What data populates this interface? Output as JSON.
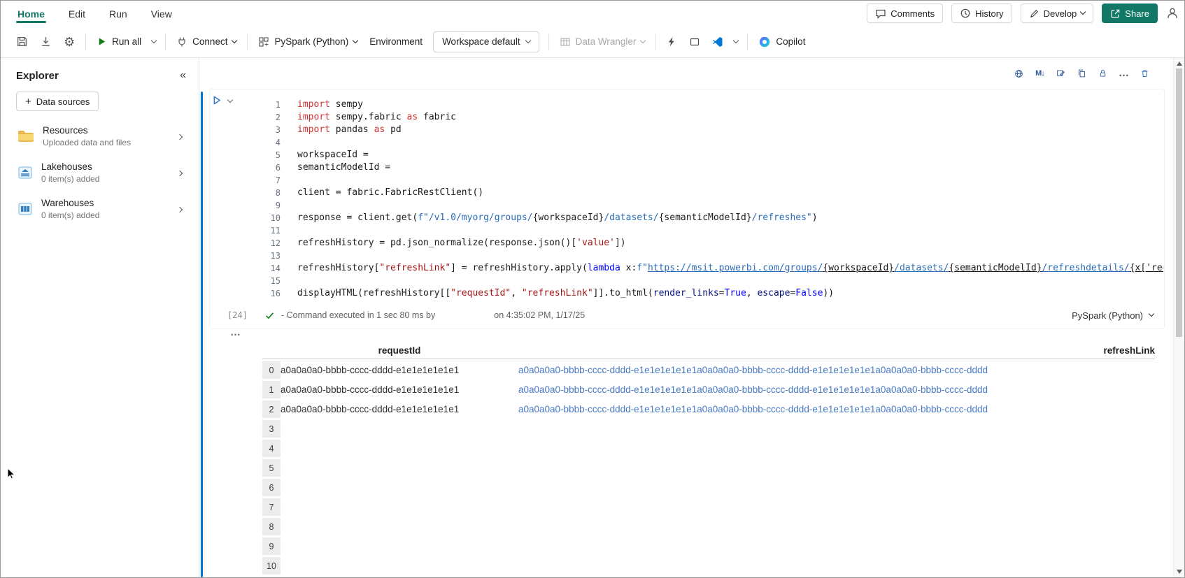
{
  "colors": {
    "accent_green": "#117865",
    "active_cell_blue": "#0078d4",
    "link_blue": "#4779c4",
    "run_green": "#107c10"
  },
  "glyphs": {
    "gear": "⚙",
    "plus": "+",
    "collapse": "«",
    "markdown": "M↓",
    "more": "…",
    "output_handle": "…"
  },
  "menu": {
    "tabs": [
      "Home",
      "Edit",
      "Run",
      "View"
    ],
    "comments": "Comments",
    "history": "History",
    "develop": "Develop",
    "share": "Share"
  },
  "toolbar": {
    "run_all": "Run all",
    "connect": "Connect",
    "kernel": "PySpark (Python)",
    "environment": "Environment",
    "workspace": "Workspace default",
    "data_wrangler": "Data Wrangler",
    "copilot": "Copilot"
  },
  "explorer": {
    "title": "Explorer",
    "add_button": "Data sources",
    "items": [
      {
        "label": "Resources",
        "sub": "Uploaded data and files",
        "icon": "folder-icon"
      },
      {
        "label": "Lakehouses",
        "sub": "0 item(s) added",
        "icon": "lakehouse-icon"
      },
      {
        "label": "Warehouses",
        "sub": "0 item(s) added",
        "icon": "warehouse-icon"
      }
    ]
  },
  "cell": {
    "execution_count": "[24]",
    "status": "- Command executed in 1 sec 80 ms by",
    "status_time": "on 4:35:02 PM, 1/17/25",
    "kernel_label": "PySpark (Python)",
    "code_lines": [
      [
        {
          "t": "import",
          "c": "kw"
        },
        {
          "t": " sempy",
          "c": "pl"
        }
      ],
      [
        {
          "t": "import",
          "c": "kw"
        },
        {
          "t": " sempy.fabric ",
          "c": "pl"
        },
        {
          "t": "as",
          "c": "kw"
        },
        {
          "t": " fabric",
          "c": "pl"
        }
      ],
      [
        {
          "t": "import",
          "c": "kw"
        },
        {
          "t": " pandas ",
          "c": "pl"
        },
        {
          "t": "as",
          "c": "kw"
        },
        {
          "t": " pd",
          "c": "pl"
        }
      ],
      [],
      [
        {
          "t": "workspaceId = ",
          "c": "pl"
        }
      ],
      [
        {
          "t": "semanticModelId = ",
          "c": "pl"
        }
      ],
      [],
      [
        {
          "t": "client = fabric.FabricRestClient()",
          "c": "pl"
        }
      ],
      [],
      [
        {
          "t": "response = client.get(",
          "c": "pl"
        },
        {
          "t": "f\"/v1.0/myorg/groups/",
          "c": "fstr"
        },
        {
          "t": "{workspaceId}",
          "c": "br"
        },
        {
          "t": "/datasets/",
          "c": "fstr"
        },
        {
          "t": "{semanticModelId}",
          "c": "br"
        },
        {
          "t": "/refreshes\"",
          "c": "fstr"
        },
        {
          "t": ")",
          "c": "pl"
        }
      ],
      [],
      [
        {
          "t": "refreshHistory = pd.json_normalize(response.json()[",
          "c": "pl"
        },
        {
          "t": "'value'",
          "c": "str"
        },
        {
          "t": "])",
          "c": "pl"
        }
      ],
      [],
      [
        {
          "t": "refreshHistory[",
          "c": "pl"
        },
        {
          "t": "\"refreshLink\"",
          "c": "str"
        },
        {
          "t": "] = refreshHistory.apply(",
          "c": "pl"
        },
        {
          "t": "lambda",
          "c": "kwb"
        },
        {
          "t": " x:",
          "c": "pl"
        },
        {
          "t": "f\"",
          "c": "fstr"
        },
        {
          "t": "https://msit.powerbi.com/groups/",
          "c": "lnk"
        },
        {
          "t": "{workspaceId}",
          "c": "blnk"
        },
        {
          "t": "/datasets/",
          "c": "lnk"
        },
        {
          "t": "{semanticModelId}",
          "c": "blnk"
        },
        {
          "t": "/refreshdetails/",
          "c": "lnk"
        },
        {
          "t": "{x['requ",
          "c": "blnk"
        }
      ],
      [],
      [
        {
          "t": "displayHTML(refreshHistory[[",
          "c": "pl"
        },
        {
          "t": "\"requestId\"",
          "c": "str"
        },
        {
          "t": ", ",
          "c": "pl"
        },
        {
          "t": "\"refreshLink\"",
          "c": "str"
        },
        {
          "t": "]].to_html(",
          "c": "pl"
        },
        {
          "t": "render_links",
          "c": "param"
        },
        {
          "t": "=",
          "c": "pl"
        },
        {
          "t": "True",
          "c": "kwb"
        },
        {
          "t": ", ",
          "c": "pl"
        },
        {
          "t": "escape",
          "c": "param"
        },
        {
          "t": "=",
          "c": "pl"
        },
        {
          "t": "False",
          "c": "kwb"
        },
        {
          "t": "))",
          "c": "pl"
        }
      ]
    ]
  },
  "output": {
    "columns": [
      "requestId",
      "refreshLink"
    ],
    "rows": [
      {
        "index": "0",
        "requestId": "a0a0a0a0-bbbb-cccc-dddd-e1e1e1e1e1e1",
        "refreshLink": "a0a0a0a0-bbbb-cccc-dddd-e1e1e1e1e1e1a0a0a0a0-bbbb-cccc-dddd-e1e1e1e1e1e1a0a0a0a0-bbbb-cccc-dddd"
      },
      {
        "index": "1",
        "requestId": "a0a0a0a0-bbbb-cccc-dddd-e1e1e1e1e1e1",
        "refreshLink": "a0a0a0a0-bbbb-cccc-dddd-e1e1e1e1e1e1a0a0a0a0-bbbb-cccc-dddd-e1e1e1e1e1e1a0a0a0a0-bbbb-cccc-dddd"
      },
      {
        "index": "2",
        "requestId": "a0a0a0a0-bbbb-cccc-dddd-e1e1e1e1e1e1",
        "refreshLink": "a0a0a0a0-bbbb-cccc-dddd-e1e1e1e1e1e1a0a0a0a0-bbbb-cccc-dddd-e1e1e1e1e1e1a0a0a0a0-bbbb-cccc-dddd"
      },
      {
        "index": "3",
        "requestId": "",
        "refreshLink": ""
      },
      {
        "index": "4",
        "requestId": "",
        "refreshLink": ""
      },
      {
        "index": "5",
        "requestId": "",
        "refreshLink": ""
      },
      {
        "index": "6",
        "requestId": "",
        "refreshLink": ""
      },
      {
        "index": "7",
        "requestId": "",
        "refreshLink": ""
      },
      {
        "index": "8",
        "requestId": "",
        "refreshLink": ""
      },
      {
        "index": "9",
        "requestId": "",
        "refreshLink": ""
      },
      {
        "index": "10",
        "requestId": "",
        "refreshLink": ""
      }
    ]
  }
}
